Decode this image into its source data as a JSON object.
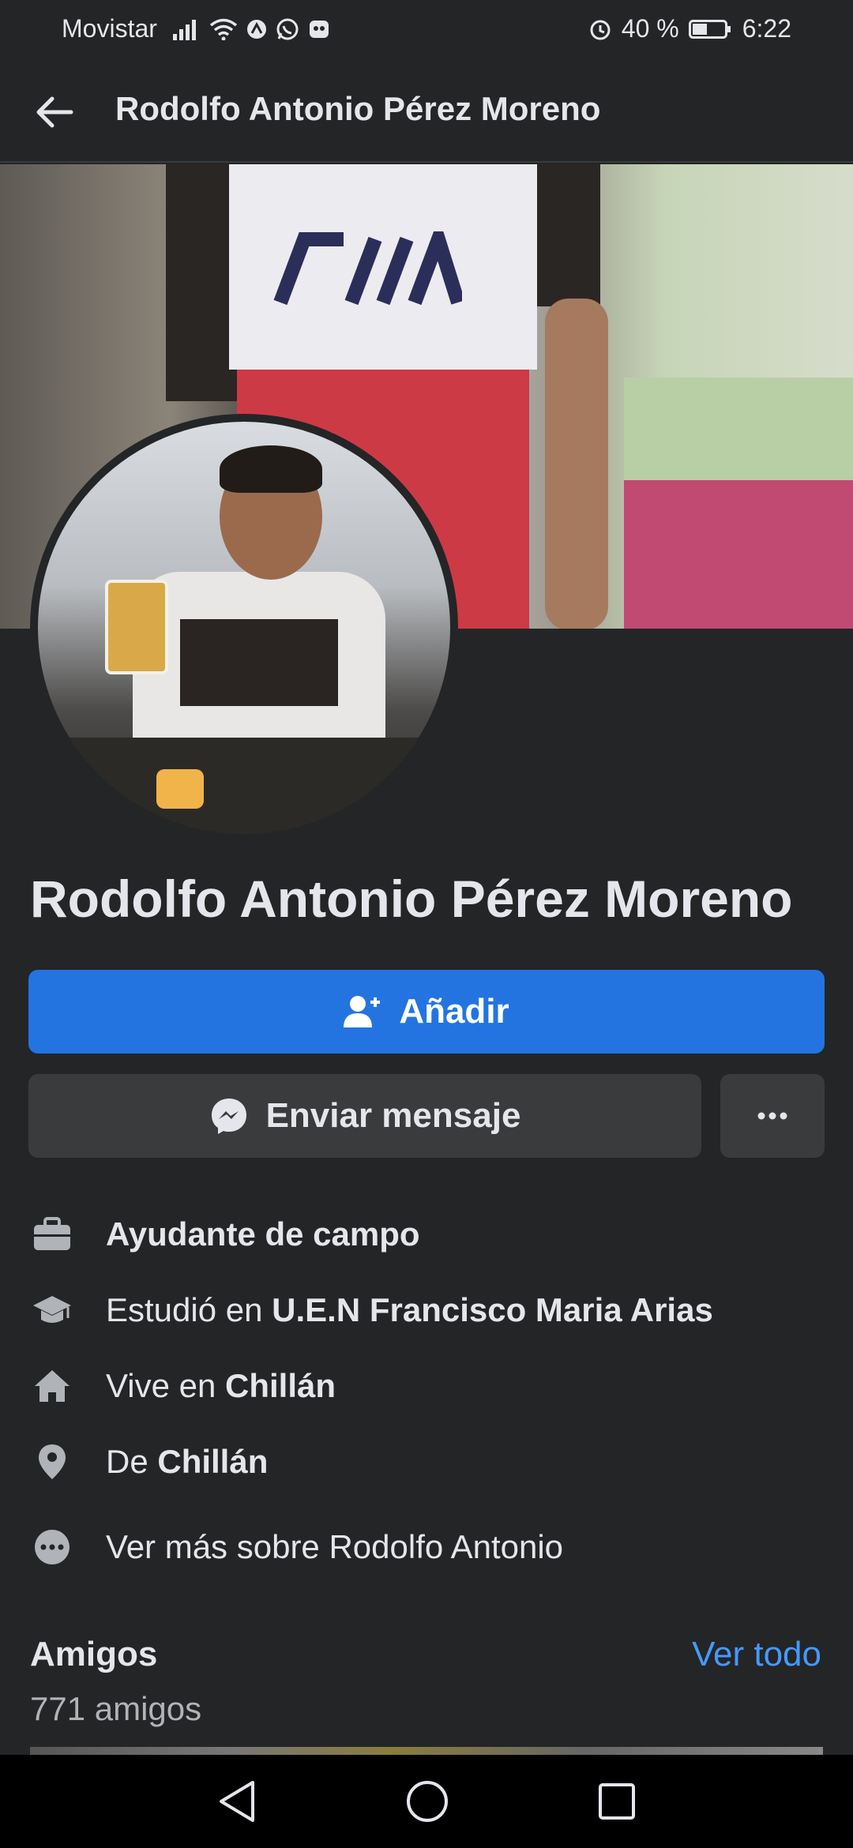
{
  "status_bar": {
    "carrier": "Movistar",
    "battery": "40 %",
    "time": "6:22"
  },
  "app_bar": {
    "title": "Rodolfo Antonio Pérez Moreno"
  },
  "profile": {
    "name": "Rodolfo Antonio Pérez Moreno"
  },
  "actions": {
    "add_label": "Añadir",
    "message_label": "Enviar mensaje"
  },
  "info": {
    "job": "Ayudante de campo",
    "studied_prefix": "Estudió en ",
    "studied_place": "U.E.N Francisco Maria Arias",
    "lives_prefix": "Vive en ",
    "lives_place": "Chillán",
    "from_prefix": "De ",
    "from_place": "Chillán",
    "see_more": "Ver más sobre Rodolfo Antonio"
  },
  "friends": {
    "heading": "Amigos",
    "count": "771 amigos",
    "see_all": "Ver todo"
  },
  "colors": {
    "background": "#242526",
    "primary_button": "#2374e1",
    "link": "#4599ff"
  }
}
